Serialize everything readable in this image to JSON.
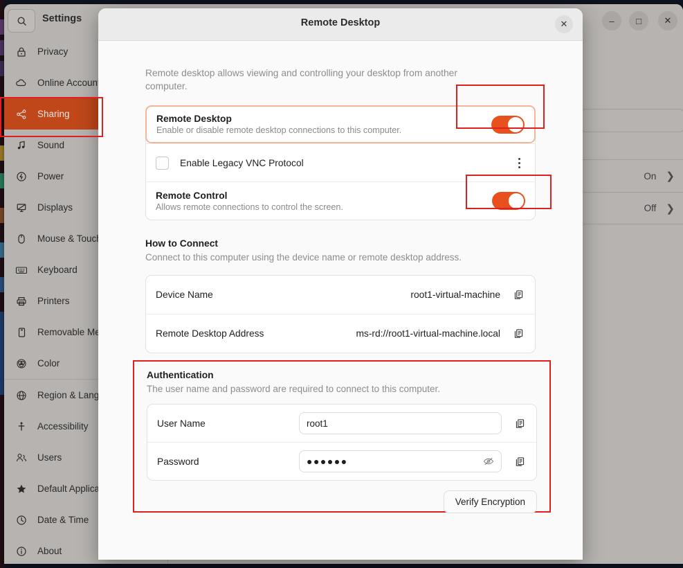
{
  "desktop": {
    "bg_color": "#0e1320",
    "dock_color": "#1e0f14"
  },
  "settings_window": {
    "title": "Settings",
    "search_icon": "search-icon",
    "window_controls": {
      "minimize": "–",
      "maximize": "□",
      "close": "✕"
    },
    "sidebar": {
      "items": [
        {
          "label": "Privacy",
          "icon": "lock-icon",
          "active": false
        },
        {
          "label": "Online Accounts",
          "icon": "cloud-icon",
          "active": false
        },
        {
          "label": "Sharing",
          "icon": "share-icon",
          "active": true
        },
        {
          "label": "Sound",
          "icon": "music-note-icon",
          "active": false
        },
        {
          "label": "Power",
          "icon": "power-icon",
          "active": false
        },
        {
          "label": "Displays",
          "icon": "display-icon",
          "active": false
        },
        {
          "label": "Mouse & Touchpad",
          "icon": "mouse-icon",
          "active": false
        },
        {
          "label": "Keyboard",
          "icon": "keyboard-icon",
          "active": false
        },
        {
          "label": "Printers",
          "icon": "printer-icon",
          "active": false
        },
        {
          "label": "Removable Media",
          "icon": "removable-media-icon",
          "active": false
        },
        {
          "label": "Color",
          "icon": "color-icon",
          "active": false
        },
        {
          "label": "Region & Language",
          "icon": "globe-icon",
          "active": false
        },
        {
          "label": "Accessibility",
          "icon": "accessibility-icon",
          "active": false
        },
        {
          "label": "Users",
          "icon": "users-icon",
          "active": false
        },
        {
          "label": "Default Applications",
          "icon": "star-icon",
          "active": false
        },
        {
          "label": "Date & Time",
          "icon": "clock-icon",
          "active": false
        },
        {
          "label": "About",
          "icon": "info-icon",
          "active": false
        }
      ]
    },
    "background_rows": [
      {
        "value": "On",
        "chevron": "❯"
      },
      {
        "value": "Off",
        "chevron": "❯"
      }
    ]
  },
  "dialog": {
    "title": "Remote Desktop",
    "close_label": "✕",
    "intro": "Remote desktop allows viewing and controlling your desktop from another computer.",
    "remote_desktop": {
      "title": "Remote Desktop",
      "subtitle": "Enable or disable remote desktop connections to this computer.",
      "toggle_on": true,
      "toggle_color": "#e8511d"
    },
    "legacy_vnc": {
      "label": "Enable Legacy VNC Protocol",
      "checked": false,
      "menu_icon": "kebab-menu-icon"
    },
    "remote_control": {
      "title": "Remote Control",
      "subtitle": "Allows remote connections to control the screen.",
      "toggle_on": true,
      "toggle_color": "#e8511d"
    },
    "how_to_connect": {
      "title": "How to Connect",
      "subtitle": "Connect to this computer using the device name or remote desktop address.",
      "rows": [
        {
          "key": "Device Name",
          "value": "root1-virtual-machine",
          "copy_icon": "copy-icon"
        },
        {
          "key": "Remote Desktop Address",
          "value": "ms-rd://root1-virtual-machine.local",
          "copy_icon": "copy-icon"
        }
      ]
    },
    "authentication": {
      "title": "Authentication",
      "subtitle": "The user name and password are required to connect to this computer.",
      "user_name": {
        "key": "User Name",
        "value": "root1",
        "copy_icon": "copy-icon"
      },
      "password": {
        "key": "Password",
        "value": "●●●●●●",
        "reveal_icon": "eye-slash-icon",
        "copy_icon": "copy-icon"
      },
      "verify_button": "Verify Encryption"
    }
  },
  "annotations": {
    "color": "#e02020",
    "boxes": [
      "sidebar-sharing",
      "remote-desktop-toggle",
      "remote-control-toggle",
      "authentication-section"
    ]
  }
}
